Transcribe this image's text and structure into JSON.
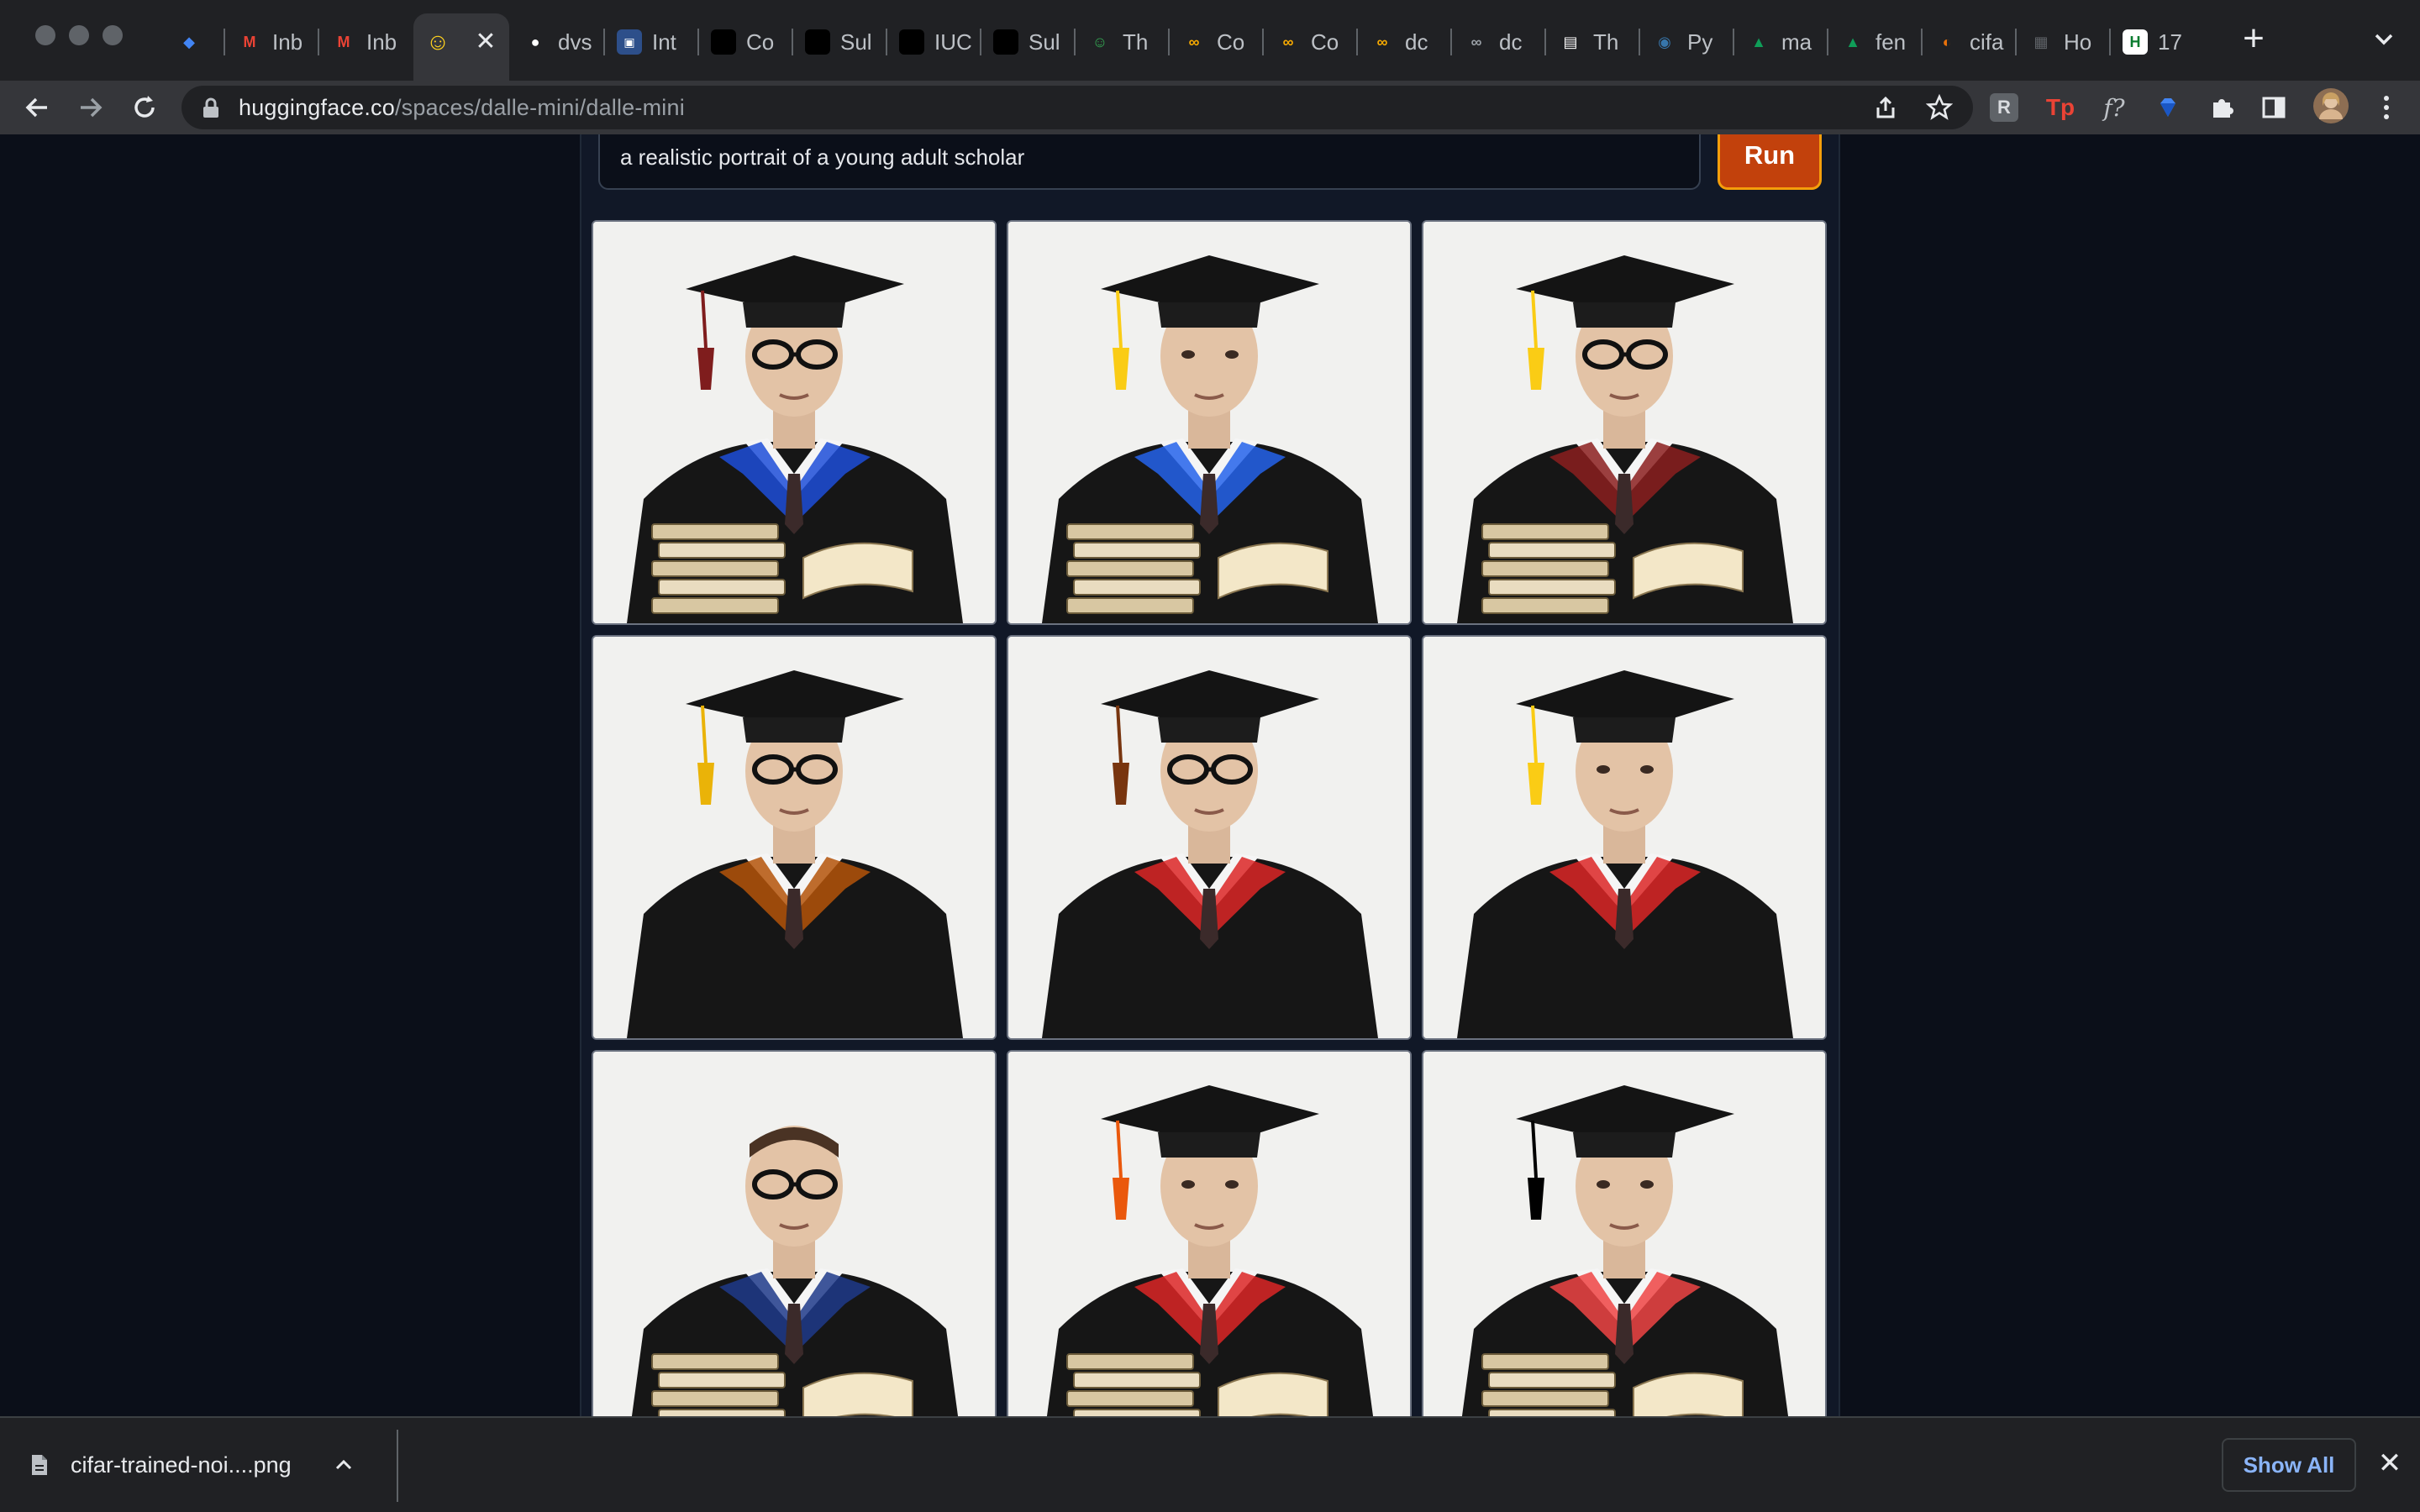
{
  "browser": {
    "tabs": [
      {
        "label": "",
        "icon": "gem-icon",
        "color": "#4285f4"
      },
      {
        "label": "Inb",
        "icon": "gmail-icon",
        "color": "#ea4335"
      },
      {
        "label": "Inb",
        "icon": "gmail-icon",
        "color": "#ea4335"
      },
      {
        "label": "",
        "icon": "hugging-face-icon",
        "color": "#ffd21e",
        "active": true
      },
      {
        "label": "dvs",
        "icon": "github-icon",
        "color": "#ffffff"
      },
      {
        "label": "Int",
        "icon": "tds-icon",
        "color": "#1a73e8"
      },
      {
        "label": "Co",
        "icon": "notion-icon",
        "color": "#000000"
      },
      {
        "label": "Sul",
        "icon": "notion-icon",
        "color": "#000000"
      },
      {
        "label": "IUC",
        "icon": "notion-icon",
        "color": "#000000"
      },
      {
        "label": "Sul",
        "icon": "notion-icon",
        "color": "#000000"
      },
      {
        "label": "Th",
        "icon": "smiley-icon",
        "color": "#34a853"
      },
      {
        "label": "Co",
        "icon": "colab-icon",
        "color": "#f9ab00"
      },
      {
        "label": "Co",
        "icon": "colab-icon",
        "color": "#f9ab00"
      },
      {
        "label": "dc",
        "icon": "colab-icon",
        "color": "#f9ab00"
      },
      {
        "label": "dc",
        "icon": "colab-icon",
        "color": "#9aa0a6"
      },
      {
        "label": "Th",
        "icon": "document-icon",
        "color": "#ffffff"
      },
      {
        "label": "Py",
        "icon": "python-icon",
        "color": "#3776ab"
      },
      {
        "label": "ma",
        "icon": "drive-icon",
        "color": "#0f9d58"
      },
      {
        "label": "fen",
        "icon": "drive-icon",
        "color": "#0f9d58"
      },
      {
        "label": "cifa",
        "icon": "globe-icon",
        "color": "#e8710a"
      },
      {
        "label": "Ho",
        "icon": "image-icon",
        "color": "#5f6368"
      },
      {
        "label": "17",
        "icon": "hp-icon",
        "color": "#0a7c2f"
      }
    ],
    "url_host": "huggingface.co",
    "url_path": "/spaces/dalle-mini/dalle-mini",
    "extensions": [
      {
        "icon": "r-extension-icon",
        "label": "R",
        "color": "#9aa0a6"
      },
      {
        "icon": "tp-extension-icon",
        "label": "Tp",
        "color": "#ea4335"
      },
      {
        "icon": "function-extension-icon",
        "label": "f?",
        "color": "#bdc1c6"
      },
      {
        "icon": "gem-extension-icon",
        "label": "",
        "color": "#4285f4"
      }
    ]
  },
  "app": {
    "prompt_value": "a realistic portrait of a young adult scholar",
    "run_label": "Run",
    "results": [
      {
        "description": "graduate with books"
      },
      {
        "description": "graduate holding open book"
      },
      {
        "description": "graduate with glasses and books"
      },
      {
        "description": "graduate with glasses"
      },
      {
        "description": "graduate with round glasses"
      },
      {
        "description": "graduate with tie"
      },
      {
        "description": "scholar with dark glasses"
      },
      {
        "description": "graduate with tassel"
      },
      {
        "description": "graduate reading book"
      }
    ]
  },
  "downloads": {
    "file_name": "cifar-trained-noi....png",
    "show_all_label": "Show All"
  },
  "colors": {
    "page_bg": "#0b0f19",
    "panel_bg": "#111827",
    "run_button": "#c2410c",
    "link_blue": "#8ab4f8"
  }
}
